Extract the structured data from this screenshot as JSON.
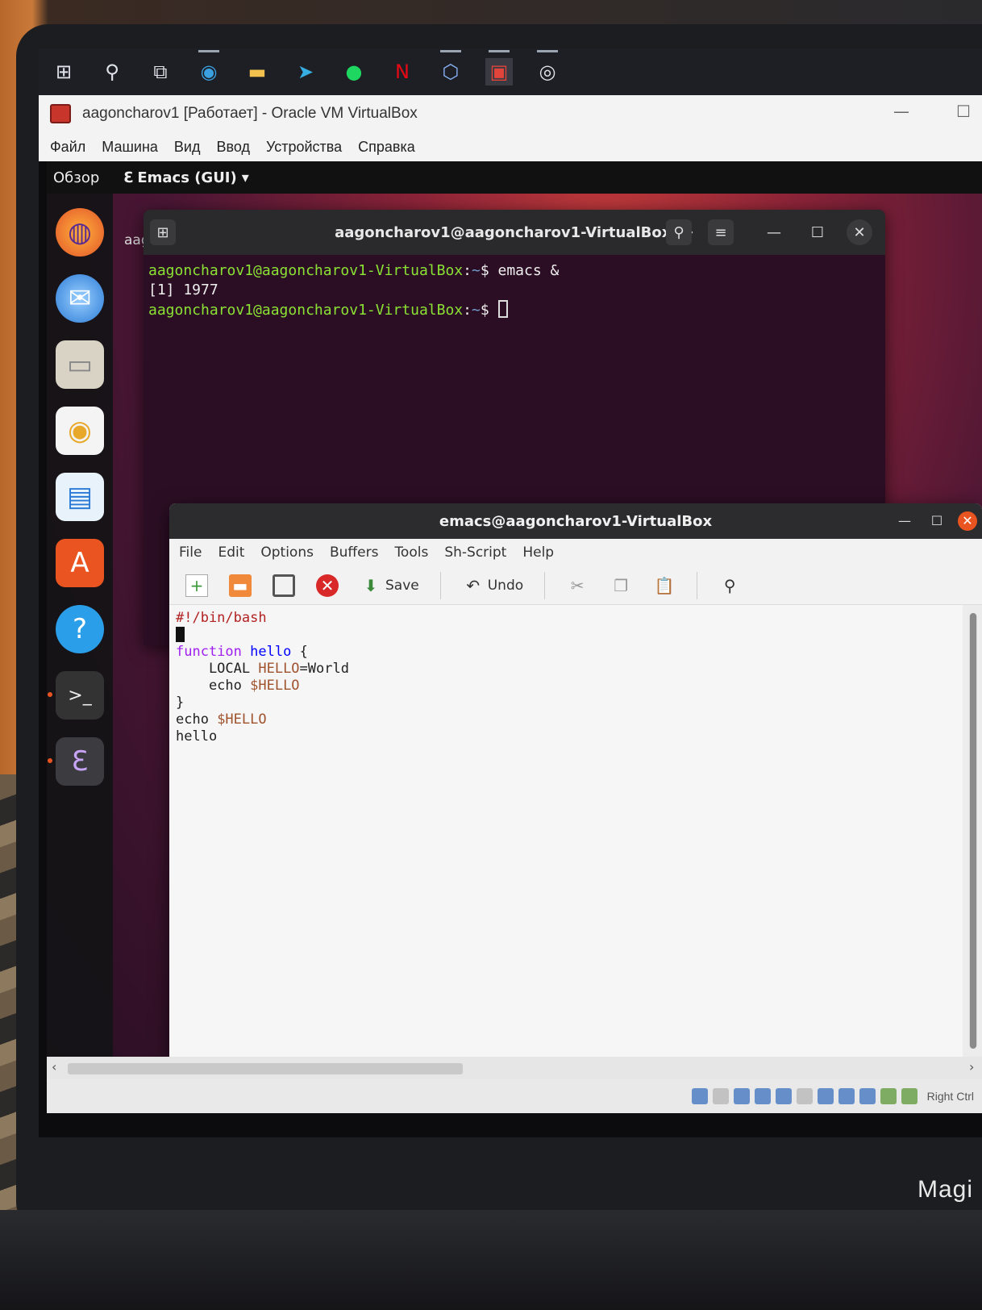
{
  "host_taskbar": {
    "icons": [
      "windows-start-icon",
      "search-icon",
      "task-view-icon",
      "edge-icon",
      "file-explorer-icon",
      "telegram-icon",
      "spotify-icon",
      "netflix-icon",
      "virtualbox-manager-icon",
      "virtualbox-vm-icon",
      "obs-icon"
    ]
  },
  "vbox": {
    "title": "aagoncharov1 [Работает] - Oracle VM VirtualBox",
    "menu": [
      "Файл",
      "Машина",
      "Вид",
      "Ввод",
      "Устройства",
      "Справка"
    ],
    "host_key": "Right Ctrl"
  },
  "guest": {
    "topbar": {
      "activities": "Обзор",
      "app": "Emacs (GUI)"
    },
    "dock": [
      "firefox-icon",
      "thunderbird-icon",
      "files-icon",
      "rhythmbox-icon",
      "writer-icon",
      "software-icon",
      "help-icon",
      "terminal-icon",
      "emacs-icon"
    ],
    "desktop_partial": {
      "label": "aag"
    }
  },
  "terminal": {
    "title": "aagoncharov1@aagoncharov1-VirtualBox: ~",
    "lines": [
      {
        "user": "aagoncharov1@aagoncharov1-VirtualBox",
        "sep": ":",
        "path": "~",
        "cmd": "$ emacs &"
      },
      {
        "output": "[1] 1977"
      },
      {
        "user": "aagoncharov1@aagoncharov1-VirtualBox",
        "sep": ":",
        "path": "~",
        "cmd": "$ "
      }
    ]
  },
  "emacs": {
    "title": "emacs@aagoncharov1-VirtualBox",
    "menu": [
      "File",
      "Edit",
      "Options",
      "Buffers",
      "Tools",
      "Sh-Script",
      "Help"
    ],
    "toolbar": {
      "save": "Save",
      "undo": "Undo"
    },
    "code": {
      "shebang": "#!/bin/bash",
      "kw_function": "function",
      "fn_name": "hello",
      "brace_open": " {",
      "local_line_pre": "    LOCAL ",
      "local_var": "HELLO",
      "local_val": "=World",
      "echo1_pre": "    echo ",
      "echo1_var": "$HELLO",
      "brace_close": "}",
      "echo2_pre": "echo ",
      "echo2_var": "$HELLO",
      "call": "hello"
    }
  },
  "colors": {
    "ubuntu_orange": "#e95420",
    "prompt_green": "#8ae234",
    "path_blue": "#729fcf"
  }
}
